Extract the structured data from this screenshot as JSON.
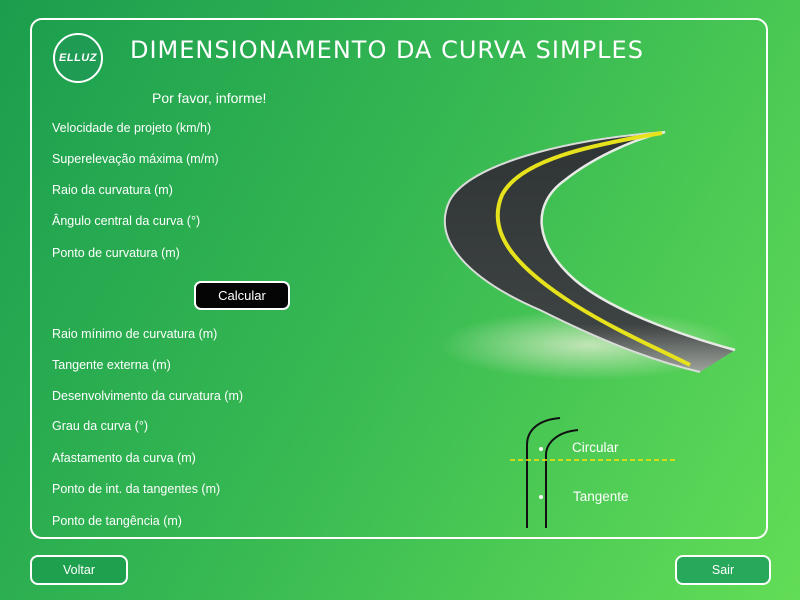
{
  "header": {
    "logo_text": "ELLUZ",
    "title": "DIMENSIONAMENTO DA CURVA SIMPLES"
  },
  "form": {
    "prompt": "Por favor, informe!",
    "inputs": [
      "Velocidade de projeto (km/h)",
      "Superelevação máxima (m/m)",
      "Raio da curvatura (m)",
      "Ângulo central da curva (°)",
      "Ponto de curvatura (m)"
    ],
    "calculate_label": "Calcular",
    "outputs": [
      "Raio mínimo de curvatura (m)",
      "Tangente externa (m)",
      "Desenvolvimento da curvatura (m)",
      "Grau da curva (°)",
      "Afastamento da curva (m)",
      "Ponto de int. da tangentes (m)",
      "Ponto de tangência (m)"
    ]
  },
  "diagram": {
    "circular_label": "Circular",
    "tangent_label": "Tangente"
  },
  "footer": {
    "back_label": "Voltar",
    "exit_label": "Sair"
  },
  "colors": {
    "background_start": "#1a9e4e",
    "background_end": "#63dd57",
    "button_dark": "#050505",
    "road_line": "#e6e31c",
    "dash_line": "#ffe100"
  }
}
